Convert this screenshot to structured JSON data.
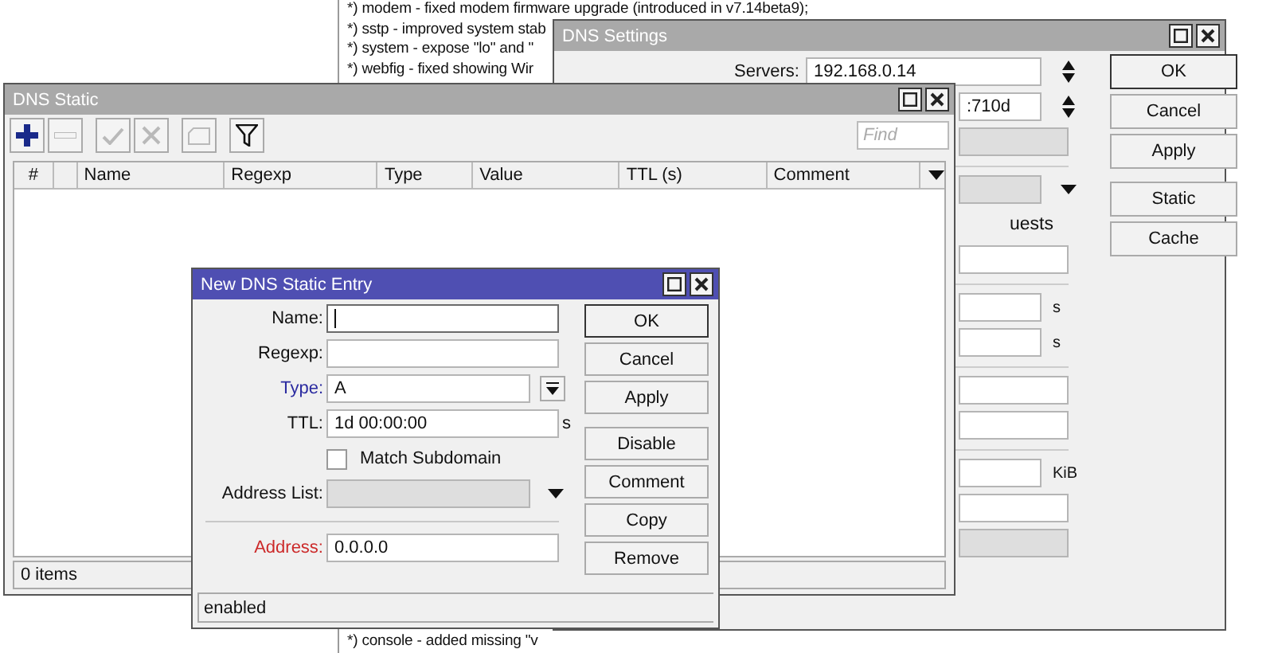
{
  "changelog": {
    "top_lines": [
      "*) modem - fixed modem firmware upgrade (introduced in v7.14beta9);",
      "*) sstp - improved system stab",
      "*) system - expose \"lo\" and \"",
      "*) webfig - fixed showing Wir"
    ],
    "bottom_line": "*) console - added missing \"v"
  },
  "dns_settings": {
    "title": "DNS Settings",
    "rows": [
      {
        "kind": "spin",
        "label": "Servers:",
        "value": "192.168.0.14"
      },
      {
        "kind": "spin",
        "value": ":710d"
      },
      {
        "kind": "field",
        "disabled": true
      },
      {
        "kind": "separator"
      },
      {
        "kind": "dropdown"
      },
      {
        "kind": "text",
        "text": "uests"
      },
      {
        "kind": "field",
        "disabled": false
      },
      {
        "kind": "separator"
      },
      {
        "kind": "field",
        "disabled": false,
        "unit": "s"
      },
      {
        "kind": "field",
        "disabled": false,
        "unit": "s"
      },
      {
        "kind": "separator"
      },
      {
        "kind": "field",
        "disabled": false
      },
      {
        "kind": "field",
        "disabled": false
      },
      {
        "kind": "separator"
      },
      {
        "kind": "field",
        "disabled": false,
        "unit": "KiB"
      },
      {
        "kind": "field",
        "disabled": false
      },
      {
        "kind": "field",
        "disabled": true
      }
    ],
    "buttons": [
      {
        "label": "OK",
        "default": true
      },
      {
        "label": "Cancel",
        "default": false
      },
      {
        "label": "Apply",
        "default": false
      },
      {
        "label": "Static",
        "default": false
      },
      {
        "label": "Cache",
        "default": false
      }
    ]
  },
  "dns_static": {
    "title": "DNS Static",
    "toolbar": [
      {
        "kind": "add",
        "disabled": false
      },
      {
        "kind": "remove",
        "disabled": true
      },
      {
        "kind": "enable",
        "disabled": true
      },
      {
        "kind": "disable",
        "disabled": true
      },
      {
        "kind": "comment",
        "disabled": true
      },
      {
        "kind": "filter",
        "disabled": false
      }
    ],
    "find": {
      "placeholder": "Find"
    },
    "columns": [
      "#",
      "Name",
      "Regexp",
      "Type",
      "Value",
      "TTL (s)",
      "Comment"
    ],
    "status": "0 items"
  },
  "new_entry": {
    "title": "New DNS Static Entry",
    "fields": [
      {
        "kind": "text",
        "label": "Name:",
        "focused": true
      },
      {
        "kind": "text",
        "label": "Regexp:",
        "focused": false
      },
      {
        "kind": "select",
        "label": "Type:",
        "value": "A",
        "color": "#2b2ba0"
      },
      {
        "kind": "text",
        "label": "TTL:",
        "value": "1d 00:00:00",
        "unit": "s",
        "focused": false
      },
      {
        "kind": "checkbox",
        "label": "Match Subdomain",
        "checked": false
      },
      {
        "kind": "dropdown",
        "label": "Address List:",
        "disabled": true
      },
      {
        "kind": "separator"
      },
      {
        "kind": "text",
        "label": "Address:",
        "value": "0.0.0.0",
        "color": "#cc2a2a",
        "focused": false
      }
    ],
    "buttons": [
      {
        "label": "OK",
        "default": true
      },
      {
        "label": "Cancel",
        "default": false
      },
      {
        "label": "Apply",
        "default": false
      },
      {
        "label": "Disable",
        "default": false
      },
      {
        "label": "Comment",
        "default": false
      },
      {
        "label": "Copy",
        "default": false
      },
      {
        "label": "Remove",
        "default": false
      }
    ],
    "status": "enabled"
  }
}
